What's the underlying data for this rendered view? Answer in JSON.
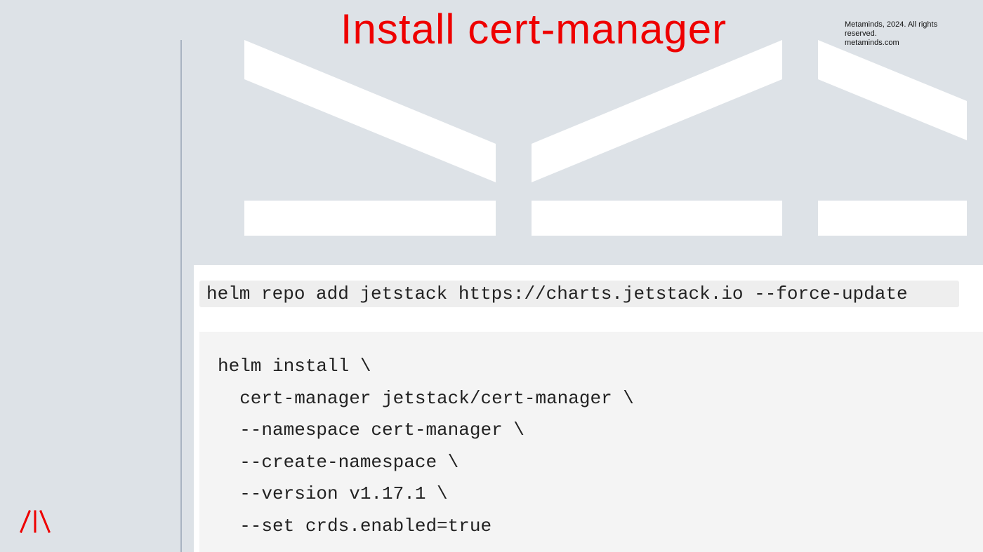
{
  "slide": {
    "title": "Install cert-manager",
    "copyright": {
      "line1": "Metaminds, 2024. All rights",
      "line2": "reserved.",
      "line3": "metaminds.com"
    },
    "logo_icon": "metaminds-logo-icon"
  },
  "code": {
    "repo_command": "helm repo add jetstack https://charts.jetstack.io --force-update",
    "install_lines": [
      "helm install \\",
      "  cert-manager jetstack/cert-manager \\",
      "  --namespace cert-manager \\",
      "  --create-namespace \\",
      "  --version v1.17.1 \\",
      "  --set crds.enabled=true"
    ]
  },
  "colors": {
    "background": "#dde2e7",
    "title": "#ee0000",
    "logo": "#ee0000",
    "code_bg": "#f4f4f4"
  }
}
